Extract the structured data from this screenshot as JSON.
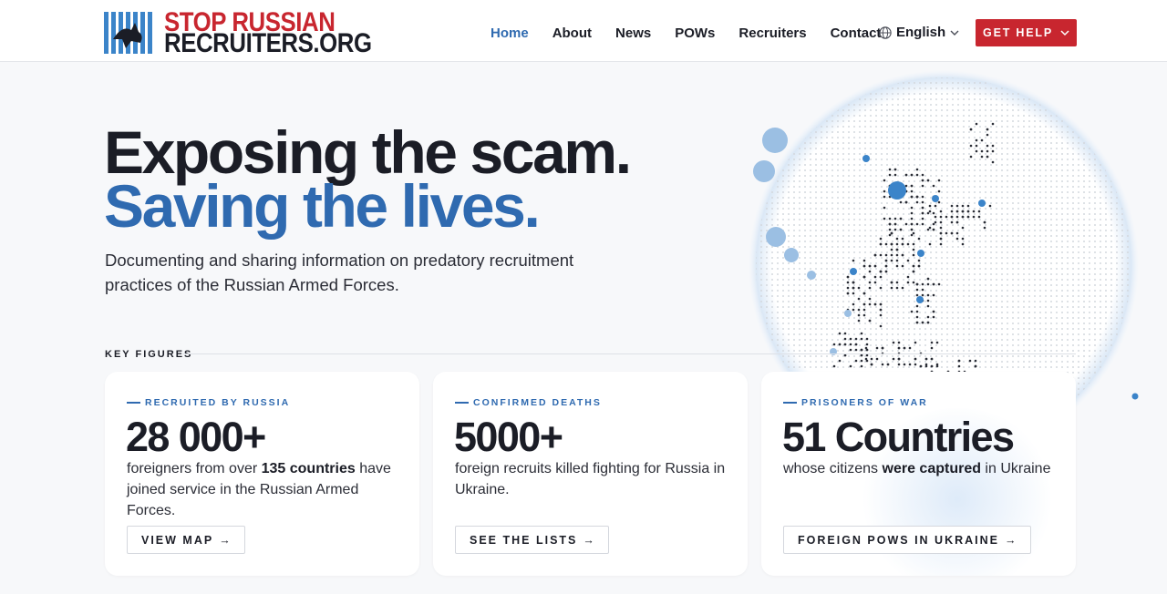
{
  "header": {
    "logo_line1": "STOP RUSSIAN",
    "logo_line2": "RECRUITERS.ORG",
    "nav": [
      {
        "label": "Home",
        "active": true
      },
      {
        "label": "About"
      },
      {
        "label": "News"
      },
      {
        "label": "POWs"
      },
      {
        "label": "Recruiters"
      },
      {
        "label": "Contact"
      }
    ],
    "language": "English",
    "help_button": "GET HELP"
  },
  "hero": {
    "line1": "Exposing the scam.",
    "line2": "Saving the lives.",
    "subtitle": "Documenting and sharing information on predatory recruitment practices of the Russian Armed Forces."
  },
  "key_figures_label": "KEY FIGURES",
  "cards": [
    {
      "kicker": "RECRUITED BY RUSSIA",
      "figure": "28 000+",
      "text_before": "foreigners from over ",
      "text_bold": "135 countries",
      "text_after": " have joined service in the Russian Armed Forces.",
      "button": "VIEW MAP"
    },
    {
      "kicker": "CONFIRMED DEATHS",
      "figure": "5000+",
      "text_before": "foreign recruits killed fighting for Russia in Ukraine.",
      "text_bold": "",
      "text_after": "",
      "button": "SEE THE LISTS"
    },
    {
      "kicker": "PRISONERS OF WAR",
      "figure": "51 Countries",
      "text_before": "whose citizens ",
      "text_bold": "were captured",
      "text_after": " in Ukraine",
      "button": "FOREIGN POWS IN UKRAINE"
    }
  ],
  "arrow_glyph": "→",
  "colors": {
    "brand_red": "#c8262f",
    "accent_blue": "#2f6ab0",
    "text_dark": "#1b1d26"
  },
  "icons": [
    "globe-icon",
    "chevron-down-icon",
    "arrow-right-icon",
    "logo-bars-icon"
  ]
}
